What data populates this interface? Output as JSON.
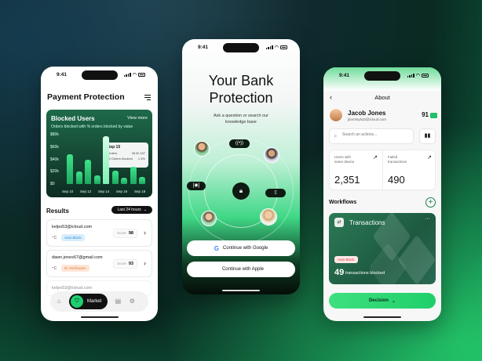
{
  "colors": {
    "accent": "#1ed070",
    "dark": "#0e1a14"
  },
  "phone1": {
    "time": "9:41",
    "title": "Payment Protection",
    "blocked_card": {
      "title": "Blocked Users",
      "view_more": "View more",
      "subtitle": "Orders blocked with % orders blocked by value"
    },
    "chart_data": {
      "type": "bar",
      "categories": [
        "Sep 10",
        "Sep 11",
        "Sep 12",
        "Sep 13",
        "Sep 14",
        "Sep 15",
        "Sep 16",
        "Sep 17",
        "Sep 18"
      ],
      "x_tick_labels": [
        "Sep 10",
        "Sep 12",
        "Sep 14",
        "Sep 16",
        "Sep 18"
      ],
      "values": [
        48,
        20,
        40,
        14,
        78,
        22,
        10,
        28,
        12
      ],
      "highlight_index": 4,
      "y_tick_labels": [
        "$80k",
        "$60k",
        "$40k",
        "$20k",
        "$0"
      ],
      "ylim": [
        0,
        80
      ],
      "tooltip": {
        "date": "Sep 15",
        "orders_label": "Orders",
        "orders_value": "$132,187",
        "pct_label": "% Orders blocked",
        "pct_value": "1.3%"
      }
    },
    "results_title": "Results",
    "filter_label": "Last 24 hours",
    "results": [
      {
        "email": "kelpo53@icloud.com",
        "logo": "⁼C",
        "badge": "Auto Block",
        "score_label": "Score",
        "score": "98"
      },
      {
        "email": "dawn.jones67@gmail.com",
        "logo": "⁼C",
        "badge": "ID Verification",
        "score_label": "Score",
        "score": "93"
      }
    ],
    "peek_email": "kelpo53@icloud.com",
    "nav": {
      "active_label": "Market"
    }
  },
  "phone2": {
    "time": "9:41",
    "title_line1": "Your Bank",
    "title_line2": "Protection",
    "subtitle_line1": "Ask a question or search our",
    "subtitle_line2": "knowledge base",
    "google_label": "Continue with Google",
    "apple_label": "Continue with Apple"
  },
  "phone3": {
    "time": "9:41",
    "header": "About",
    "user": {
      "name": "Jacob Jones",
      "email": "jbomtsy532@icloud.com",
      "score": "91"
    },
    "search_placeholder": "Search an actions...",
    "stats": [
      {
        "label_line1": "Users with",
        "label_line2": "same device",
        "value": "2,351"
      },
      {
        "label_line1": "Failed",
        "label_line2": "transactions",
        "value": "490"
      }
    ],
    "workflows_title": "Workflows",
    "tx_card": {
      "title": "Transactions",
      "badge": "Auto Block",
      "count": "49",
      "count_label": "transactions blocked"
    },
    "decision_label": "Decision"
  }
}
